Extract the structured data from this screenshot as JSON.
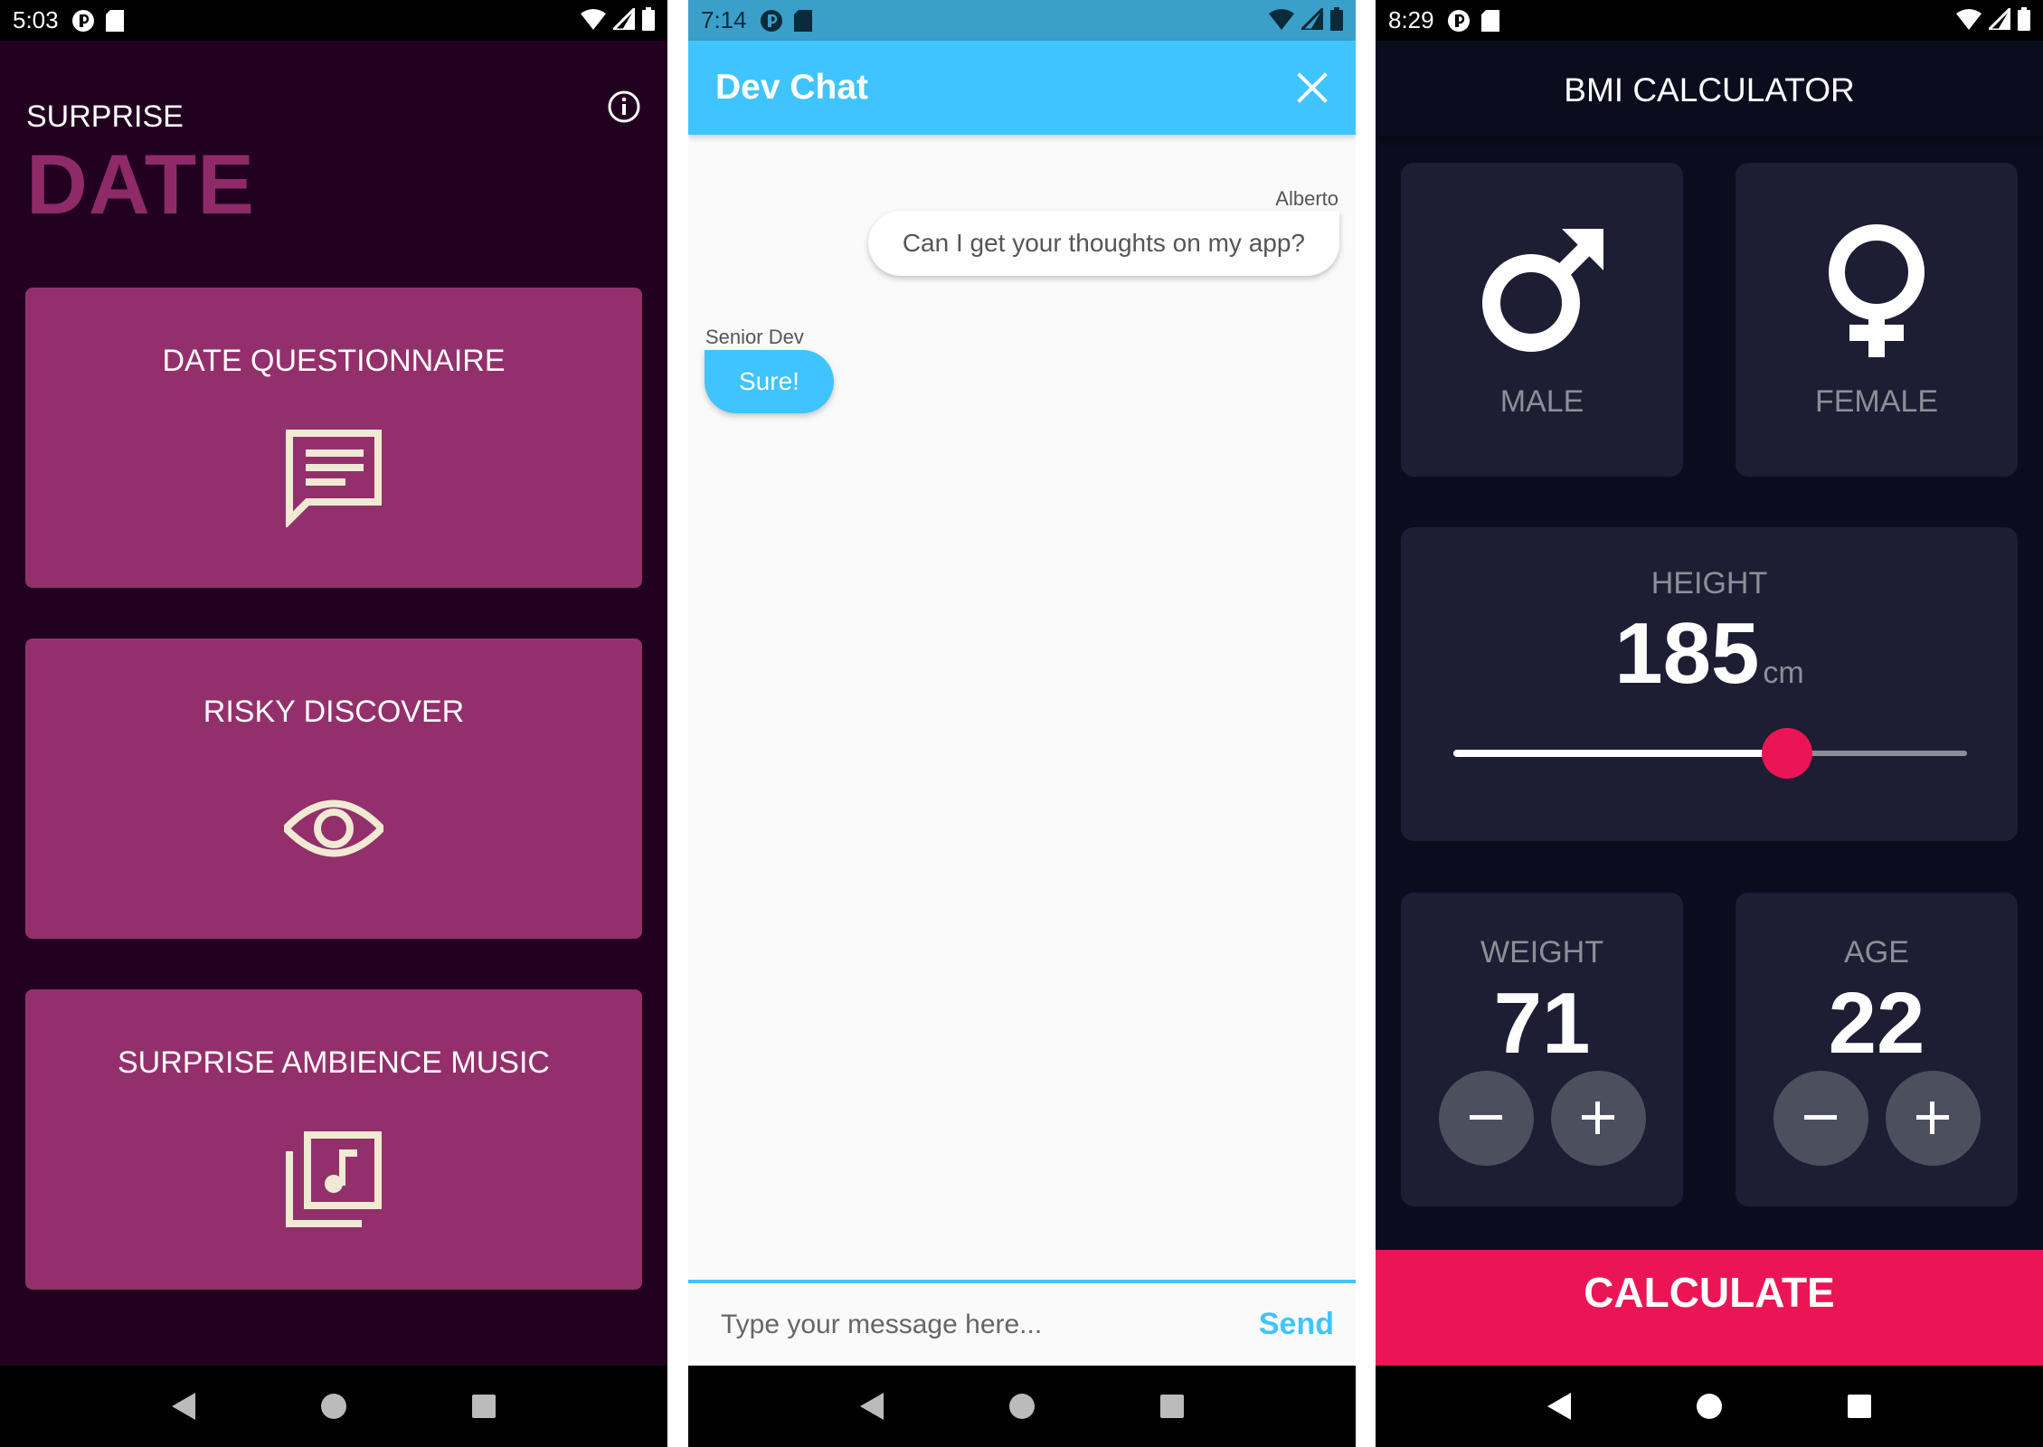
{
  "surprise_date": {
    "status_time": "5:03",
    "subtitle": "SURPRISE",
    "title": "DATE",
    "cards": [
      {
        "label": "DATE QUESTIONNAIRE",
        "icon": "chat-message-icon"
      },
      {
        "label": "RISKY DISCOVER",
        "icon": "eye-icon"
      },
      {
        "label": "SURPRISE AMBIENCE MUSIC",
        "icon": "music-library-icon"
      }
    ],
    "colors": {
      "background": "#22001f",
      "accent": "#93306c",
      "icon": "#f0ead2"
    }
  },
  "dev_chat": {
    "status_time": "7:14",
    "title": "Dev Chat",
    "messages": [
      {
        "sender": "Alberto",
        "text": "Can I get your thoughts on my app?",
        "side": "right"
      },
      {
        "sender": "Senior Dev",
        "text": "Sure!",
        "side": "left"
      }
    ],
    "input_placeholder": "Type your message here...",
    "send_label": "Send",
    "colors": {
      "accent": "#40c4ff"
    }
  },
  "bmi_calculator": {
    "status_time": "8:29",
    "title": "BMI CALCULATOR",
    "genders": [
      {
        "label": "MALE",
        "icon": "male-icon"
      },
      {
        "label": "FEMALE",
        "icon": "female-icon"
      }
    ],
    "height": {
      "label": "HEIGHT",
      "value": "185",
      "unit": "cm",
      "slider_fraction": 0.65
    },
    "weight": {
      "label": "WEIGHT",
      "value": "71"
    },
    "age": {
      "label": "AGE",
      "value": "22"
    },
    "calculate_label": "CALCULATE",
    "colors": {
      "card": "#1d1e33",
      "accent": "#eb1555",
      "background": "#0b0d1e"
    }
  }
}
